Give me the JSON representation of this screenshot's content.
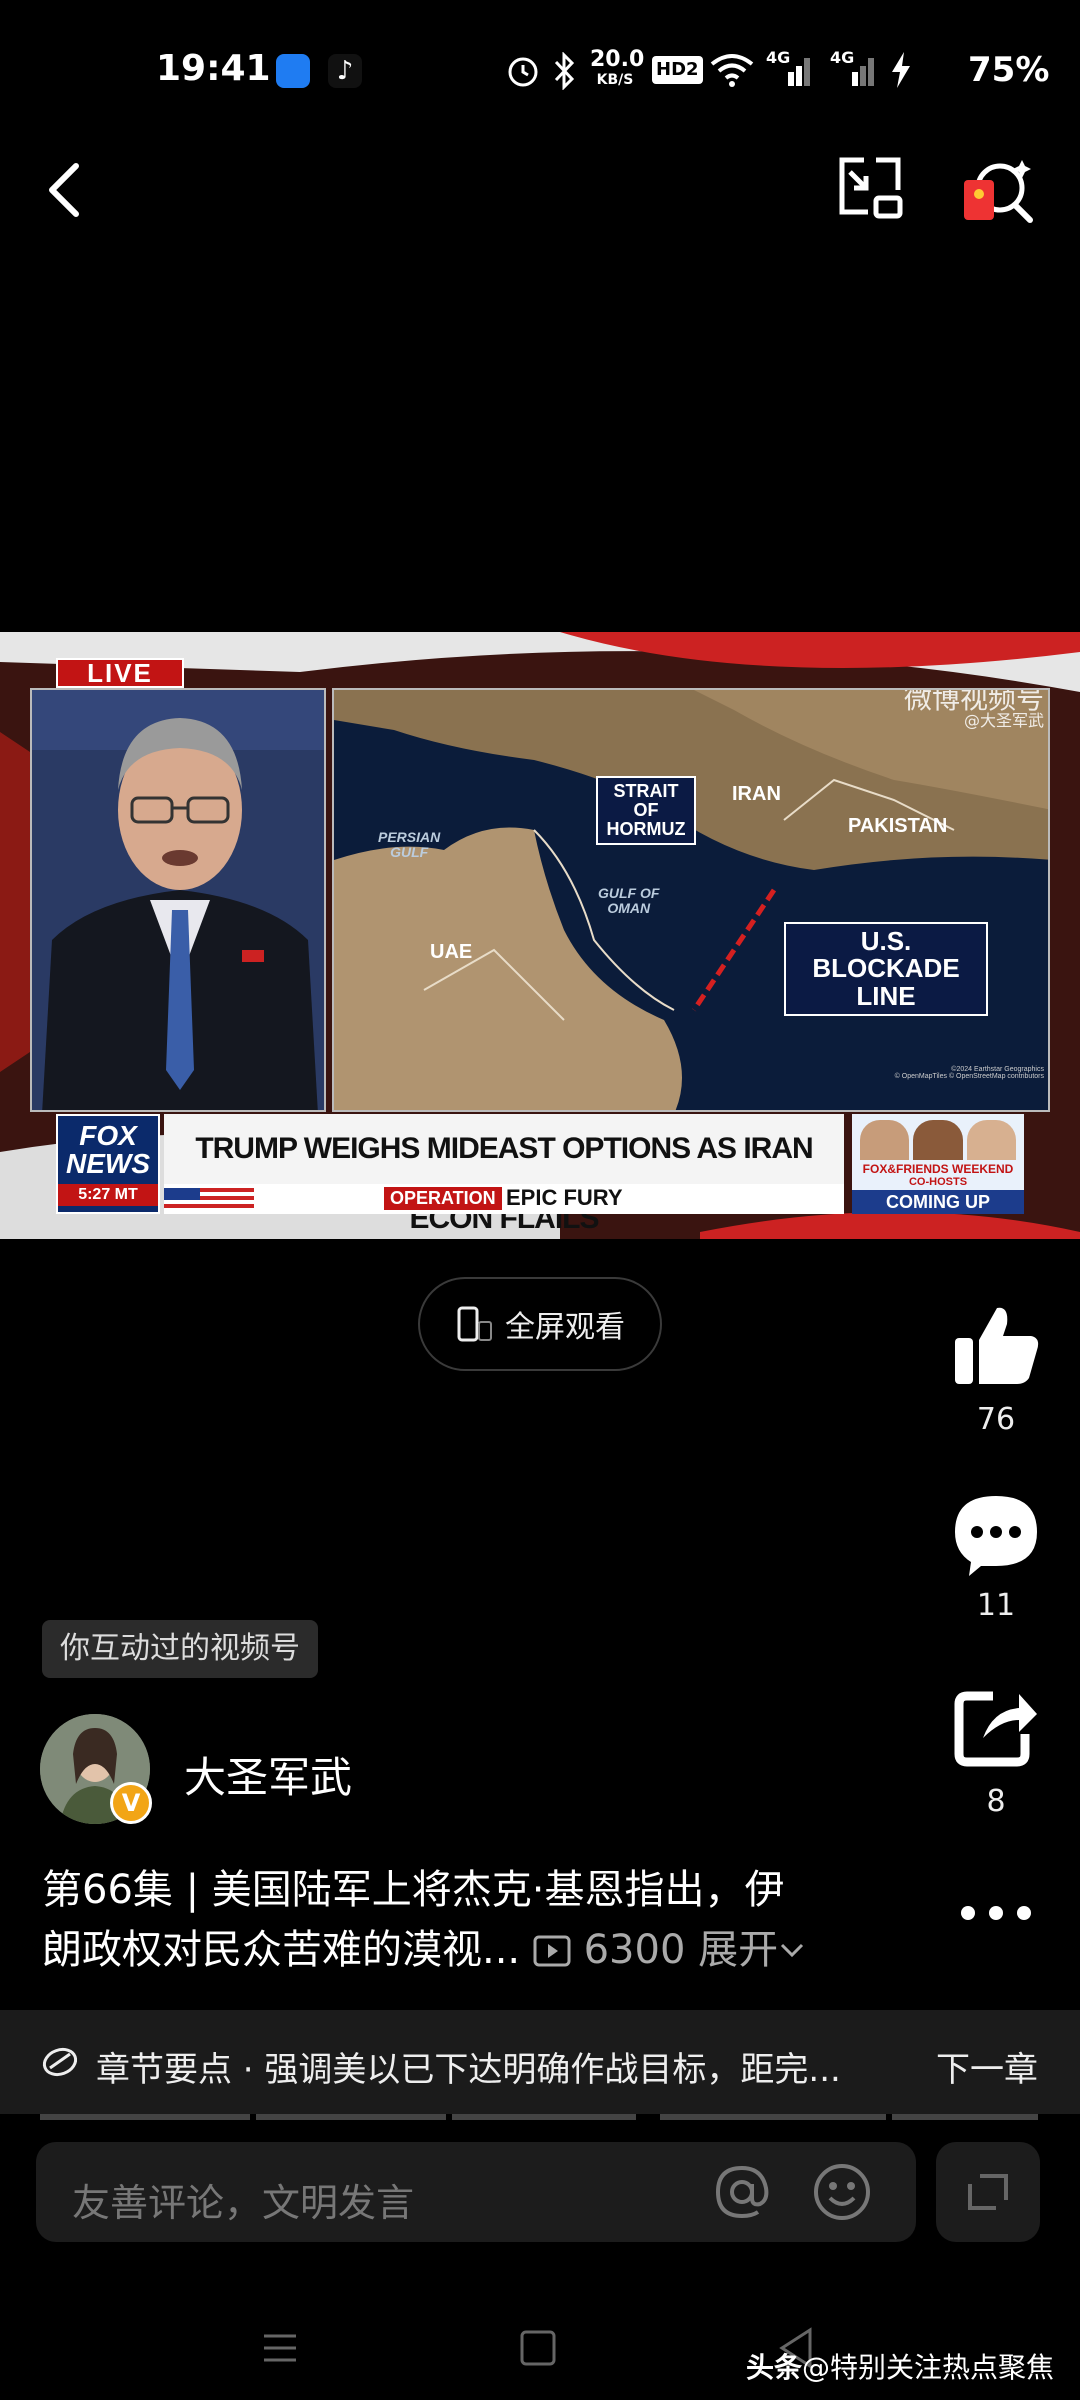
{
  "status_bar": {
    "time": "19:41",
    "net_speed_value": "20.0",
    "net_speed_unit": "KB/S",
    "hd_label": "HD2",
    "sim1_label": "4G",
    "sim2_label": "4G",
    "battery": "75%"
  },
  "video": {
    "live_badge": "LIVE",
    "watermark_title": "微博视频号",
    "watermark_handle": "@大圣军武",
    "map_labels": {
      "strait": "STRAIT OF\nHORMUZ",
      "iran": "IRAN",
      "pakistan": "PAKISTAN",
      "persian_gulf": "PERSIAN\nGULF",
      "gulf_of_oman": "GULF OF\nOMAN",
      "uae": "UAE",
      "blockade": "U.S. BLOCKADE\nLINE",
      "credit": "©2024 Earthstar Geographics\n© OpenMapTiles © OpenStreetMap contributors"
    },
    "network_logo": "FOX\nNEWS",
    "clock": "5:27 MT",
    "headline": "TRUMP WEIGHS MIDEAST OPTIONS AS IRAN ECON FLAILS",
    "operation_tag": "OPERATION",
    "operation_name": "EPIC FURY",
    "promo_title": "FOX&FRIENDS WEEKEND",
    "promo_sub": "CO-HOSTS",
    "promo_cta": "COMING UP"
  },
  "fullscreen_label": "全屏观看",
  "actions": {
    "likes": "76",
    "comments": "11",
    "shares": "8"
  },
  "interaction_tag": "你互动过的视频号",
  "author": {
    "name": "大圣军武",
    "badge": "V"
  },
  "description": {
    "line1": "第66集 | 美国陆军上将杰克·基恩指出，伊",
    "line2": "朗政权对民众苦难的漠视...",
    "views": "6300",
    "expand": "展开"
  },
  "chapter": {
    "text": "章节要点 · 强调美以已下达明确作战目标，距完...",
    "next": "下一章"
  },
  "comment": {
    "placeholder": "友善评论，文明发言"
  },
  "watermark": {
    "brand": "头条",
    "handle": "@特别关注热点聚焦"
  },
  "colors": {
    "background": "#000000",
    "fox_red": "#c21414",
    "verified": "#f2a516"
  }
}
